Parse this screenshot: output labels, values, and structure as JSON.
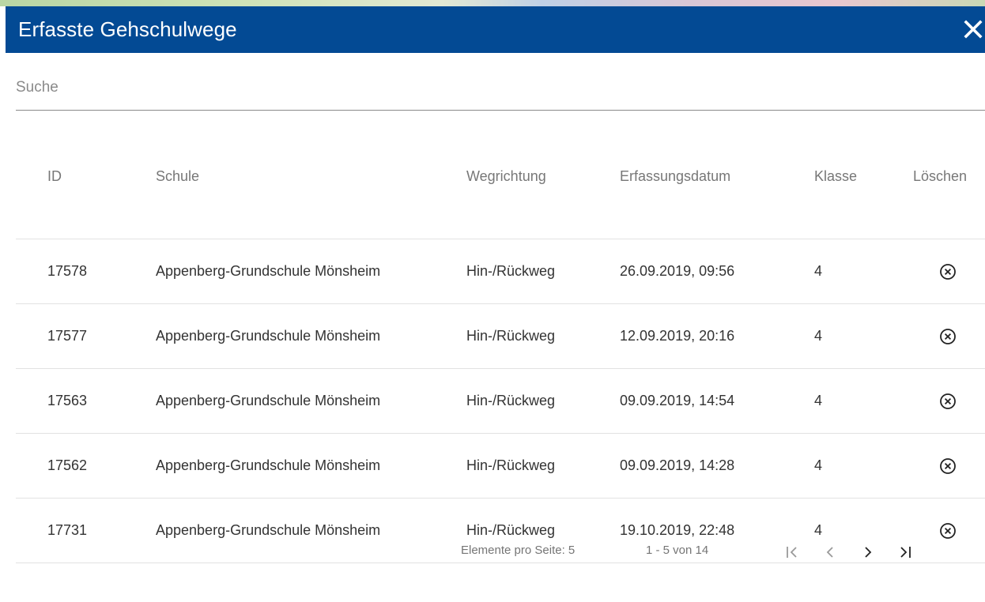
{
  "dialog": {
    "title": "Erfasste Gehschulwege"
  },
  "search": {
    "placeholder": "Suche"
  },
  "table": {
    "headers": {
      "id": "ID",
      "schule": "Schule",
      "wegrichtung": "Wegrichtung",
      "datum": "Erfassungsdatum",
      "klasse": "Klasse",
      "loeschen": "Löschen"
    },
    "rows": [
      {
        "id": "17578",
        "schule": "Appenberg-Grundschule Mönsheim",
        "wegrichtung": "Hin-/Rückweg",
        "datum": "26.09.2019, 09:56",
        "klasse": "4"
      },
      {
        "id": "17577",
        "schule": "Appenberg-Grundschule Mönsheim",
        "wegrichtung": "Hin-/Rückweg",
        "datum": "12.09.2019, 20:16",
        "klasse": "4"
      },
      {
        "id": "17563",
        "schule": "Appenberg-Grundschule Mönsheim",
        "wegrichtung": "Hin-/Rückweg",
        "datum": "09.09.2019, 14:54",
        "klasse": "4"
      },
      {
        "id": "17562",
        "schule": "Appenberg-Grundschule Mönsheim",
        "wegrichtung": "Hin-/Rückweg",
        "datum": "09.09.2019, 14:28",
        "klasse": "4"
      },
      {
        "id": "17731",
        "schule": "Appenberg-Grundschule Mönsheim",
        "wegrichtung": "Hin-/Rückweg",
        "datum": "19.10.2019, 22:48",
        "klasse": "4"
      }
    ]
  },
  "paginator": {
    "items_per_page_label": "Elemente pro Seite: 5",
    "range_label": "1 - 5 von 14"
  },
  "icons": {
    "close": "close-icon",
    "delete": "cancel-circle-icon",
    "first": "first-page-icon",
    "prev": "chevron-left-icon",
    "next": "chevron-right-icon",
    "last": "last-page-icon"
  },
  "colors": {
    "header_bg": "#034a94",
    "header_text": "#ffffff"
  }
}
